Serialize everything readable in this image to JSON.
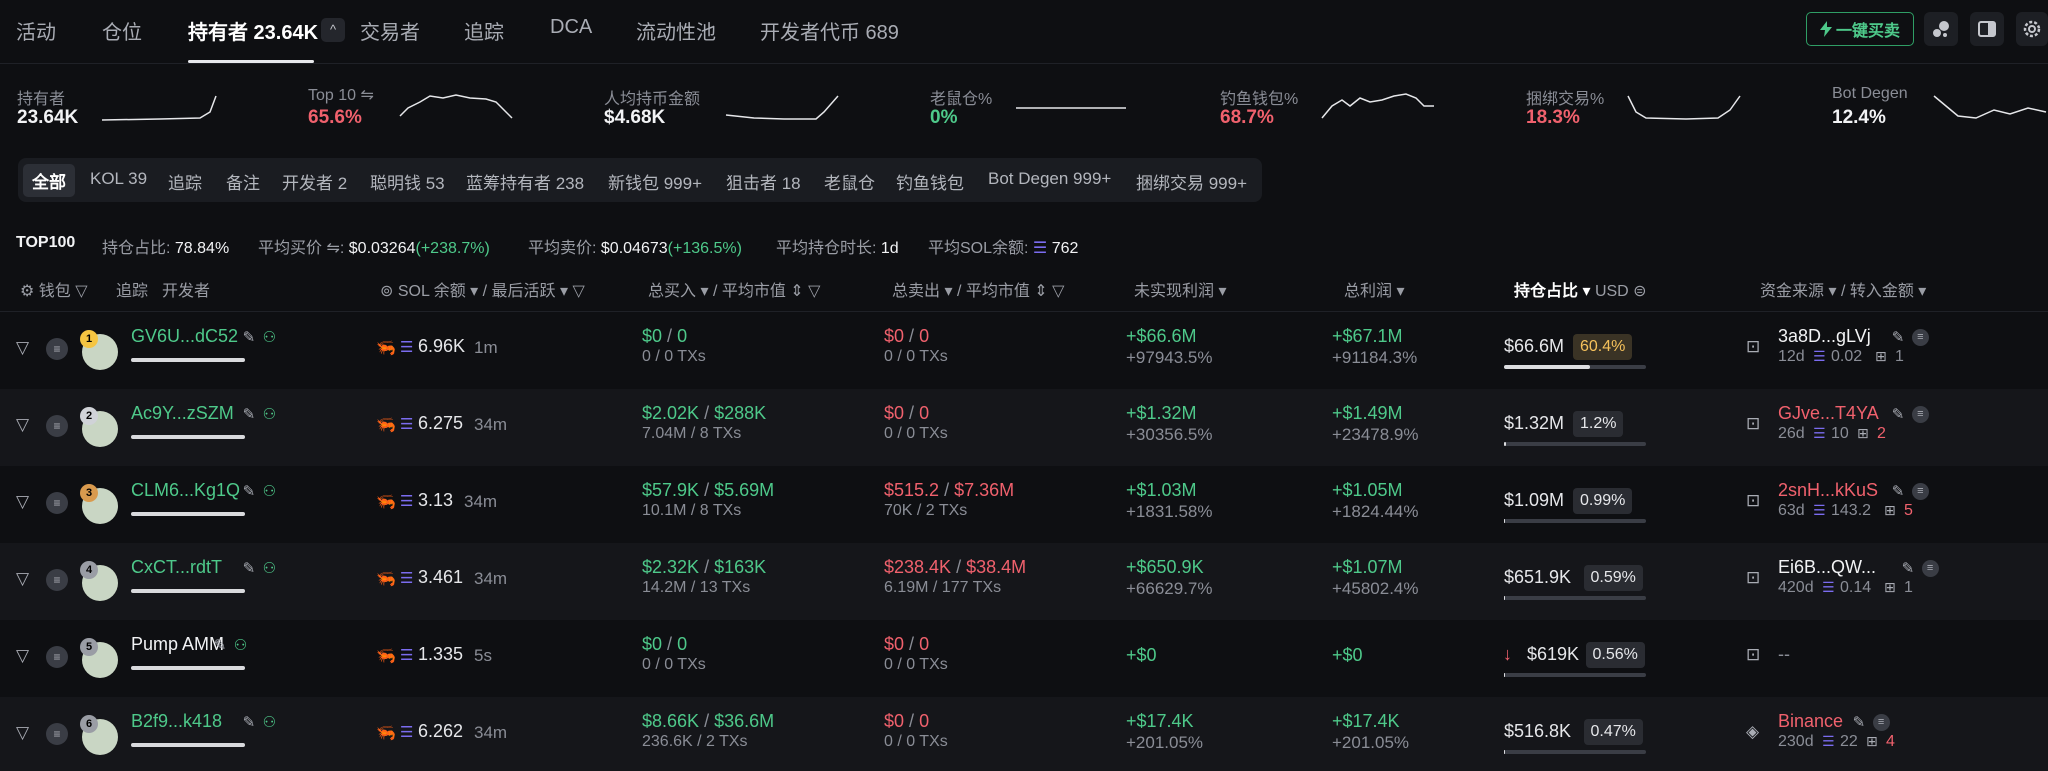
{
  "tabs": [
    {
      "label": "活动"
    },
    {
      "label": "仓位"
    },
    {
      "label": "持有者 23.64K"
    },
    {
      "label": "交易者"
    },
    {
      "label": "追踪"
    },
    {
      "label": "DCA"
    },
    {
      "label": "流动性池"
    },
    {
      "label": "开发者代币 689"
    }
  ],
  "quick_buy_label": "一键买卖",
  "stats": [
    {
      "label": "持有者",
      "value": "23.64K",
      "color": "#f2f3f5"
    },
    {
      "label": "Top 10",
      "value": "65.6%",
      "color": "#f0616d"
    },
    {
      "label": "人均持币金额",
      "value": "$4.68K",
      "color": "#f2f3f5"
    },
    {
      "label": "老鼠仓%",
      "value": "0%",
      "color": "#4ec98a"
    },
    {
      "label": "钓鱼钱包%",
      "value": "68.7%",
      "color": "#f0616d"
    },
    {
      "label": "捆绑交易%",
      "value": "18.3%",
      "color": "#f0616d"
    },
    {
      "label": "Bot Degen",
      "value": "12.4%",
      "color": "#f2f3f5"
    }
  ],
  "filters": [
    "全部",
    "KOL 39",
    "追踪",
    "备注",
    "开发者 2",
    "聪明钱 53",
    "蓝筹持有者 238",
    "新钱包 999+",
    "狙击者 18",
    "老鼠仓",
    "钓鱼钱包",
    "Bot Degen 999+",
    "捆绑交易 999+"
  ],
  "summary": {
    "top": "TOP100",
    "hold_label": "持仓占比:",
    "hold_value": "78.84%",
    "avg_buy_label": "平均买价",
    "avg_buy_value": "$0.03264",
    "avg_buy_change": "(+238.7%)",
    "avg_sell_label": "平均卖价:",
    "avg_sell_value": "$0.04673",
    "avg_sell_change": "(+136.5%)",
    "avg_hold_label": "平均持仓时长:",
    "avg_hold_value": "1d",
    "avg_sol_label": "平均SOL余额:",
    "avg_sol_value": "762"
  },
  "headers": {
    "wallet": "钱包",
    "track": "追踪",
    "dev": "开发者",
    "sol": "SOL 余额",
    "last_active": "/ 最后活跃",
    "bought": "总买入",
    "avg_mc_buy": "/ 平均市值",
    "sold": "总卖出",
    "avg_mc_sell": "/ 平均市值",
    "unrealized": "未实现利润",
    "total_pnl": "总利润",
    "hold_pct": "持仓占比",
    "usd": "USD",
    "source": "资金来源",
    "transfer": "/ 转入金额"
  },
  "rows": [
    {
      "rank": "1",
      "rank_color": "#f5c542",
      "addr": "GV6U...dC52",
      "addr_color": "#4ec98a",
      "sol": "6.96K",
      "active": "1m",
      "buy": "$0",
      "buy_mc": "0",
      "buy_sub": "0 / 0 TXs",
      "buy_color": "#4ec98a",
      "sell": "$0",
      "sell_mc": "0",
      "sell_sub": "0 / 0 TXs",
      "sell_color": "#f0616d",
      "unreal": "+$66.6M",
      "unreal_pct": "+97943.5%",
      "pnl": "+$67.1M",
      "pnl_pct": "+91184.3%",
      "hold_usd": "$66.6M",
      "hold_pct": "60.4%",
      "hold_fill": 0.604,
      "src": "3a8D...gLVj",
      "src_color": "#f2f3f5",
      "src_age": "12d",
      "src_sol": "0.02",
      "src_count": "1",
      "src_count_color": "#8a8d96"
    },
    {
      "rank": "2",
      "rank_color": "#d0d3d8",
      "addr": "Ac9Y...zSZM",
      "addr_color": "#4ec98a",
      "sol": "6.275",
      "active": "34m",
      "buy": "$2.02K",
      "buy_mc": "$288K",
      "buy_sub": "7.04M / 8 TXs",
      "buy_color": "#4ec98a",
      "sell": "$0",
      "sell_mc": "0",
      "sell_sub": "0 / 0 TXs",
      "sell_color": "#f0616d",
      "unreal": "+$1.32M",
      "unreal_pct": "+30356.5%",
      "pnl": "+$1.49M",
      "pnl_pct": "+23478.9%",
      "hold_usd": "$1.32M",
      "hold_pct": "1.2%",
      "hold_fill": 0.012,
      "src": "GJve...T4YA",
      "src_color": "#f0616d",
      "src_age": "26d",
      "src_sol": "10",
      "src_count": "2",
      "src_count_color": "#f0616d"
    },
    {
      "rank": "3",
      "rank_color": "#d99a4e",
      "addr": "CLM6...Kg1Q",
      "addr_color": "#4ec98a",
      "sol": "3.13",
      "active": "34m",
      "buy": "$57.9K",
      "buy_mc": "$5.69M",
      "buy_sub": "10.1M / 8 TXs",
      "buy_color": "#4ec98a",
      "sell": "$515.2",
      "sell_mc": "$7.36M",
      "sell_sub": "70K / 2 TXs",
      "sell_color": "#f0616d",
      "unreal": "+$1.03M",
      "unreal_pct": "+1831.58%",
      "pnl": "+$1.05M",
      "pnl_pct": "+1824.44%",
      "hold_usd": "$1.09M",
      "hold_pct": "0.99%",
      "hold_fill": 0.0099,
      "src": "2snH...kKuS",
      "src_color": "#f0616d",
      "src_age": "63d",
      "src_sol": "143.2",
      "src_count": "5",
      "src_count_color": "#f0616d"
    },
    {
      "rank": "4",
      "rank_color": "#9a9da5",
      "addr": "CxCT...rdtT",
      "addr_color": "#4ec98a",
      "sol": "3.461",
      "active": "34m",
      "buy": "$2.32K",
      "buy_mc": "$163K",
      "buy_sub": "14.2M / 13 TXs",
      "buy_color": "#4ec98a",
      "sell": "$238.4K",
      "sell_mc": "$38.4M",
      "sell_sub": "6.19M / 177 TXs",
      "sell_color": "#f0616d",
      "unreal": "+$650.9K",
      "unreal_pct": "+66629.7%",
      "pnl": "+$1.07M",
      "pnl_pct": "+45802.4%",
      "hold_usd": "$651.9K",
      "hold_pct": "0.59%",
      "hold_fill": 0.0059,
      "src": "Ei6B...QW...",
      "src_color": "#f2f3f5",
      "src_age": "420d",
      "src_sol": "0.14",
      "src_count": "1",
      "src_count_color": "#8a8d96"
    },
    {
      "rank": "5",
      "rank_color": "#9a9da5",
      "addr": "Pump AMM",
      "addr_color": "#f2f3f5",
      "sol": "1.335",
      "active": "5s",
      "buy": "$0",
      "buy_mc": "0",
      "buy_sub": "0 / 0 TXs",
      "buy_color": "#4ec98a",
      "sell": "$0",
      "sell_mc": "0",
      "sell_sub": "0 / 0 TXs",
      "sell_color": "#f0616d",
      "unreal": "+$0",
      "unreal_pct": "",
      "pnl": "+$0",
      "pnl_pct": "",
      "hold_usd": "$619K",
      "hold_pct": "0.56%",
      "hold_fill": 0.0056,
      "src": "--",
      "src_color": "#8a8d96",
      "src_age": "",
      "src_sol": "",
      "src_count": "",
      "src_count_color": "#8a8d96"
    },
    {
      "rank": "6",
      "rank_color": "#9a9da5",
      "addr": "B2f9...k418",
      "addr_color": "#4ec98a",
      "sol": "6.262",
      "active": "34m",
      "buy": "$8.66K",
      "buy_mc": "$36.6M",
      "buy_sub": "236.6K / 2 TXs",
      "buy_color": "#4ec98a",
      "sell": "$0",
      "sell_mc": "0",
      "sell_sub": "0 / 0 TXs",
      "sell_color": "#f0616d",
      "unreal": "+$17.4K",
      "unreal_pct": "+201.05%",
      "pnl": "+$17.4K",
      "pnl_pct": "+201.05%",
      "hold_usd": "$516.8K",
      "hold_pct": "0.47%",
      "hold_fill": 0.0047,
      "src": "Binance",
      "src_color": "#f0616d",
      "src_age": "230d",
      "src_sol": "22",
      "src_count": "4",
      "src_count_color": "#f0616d"
    }
  ]
}
